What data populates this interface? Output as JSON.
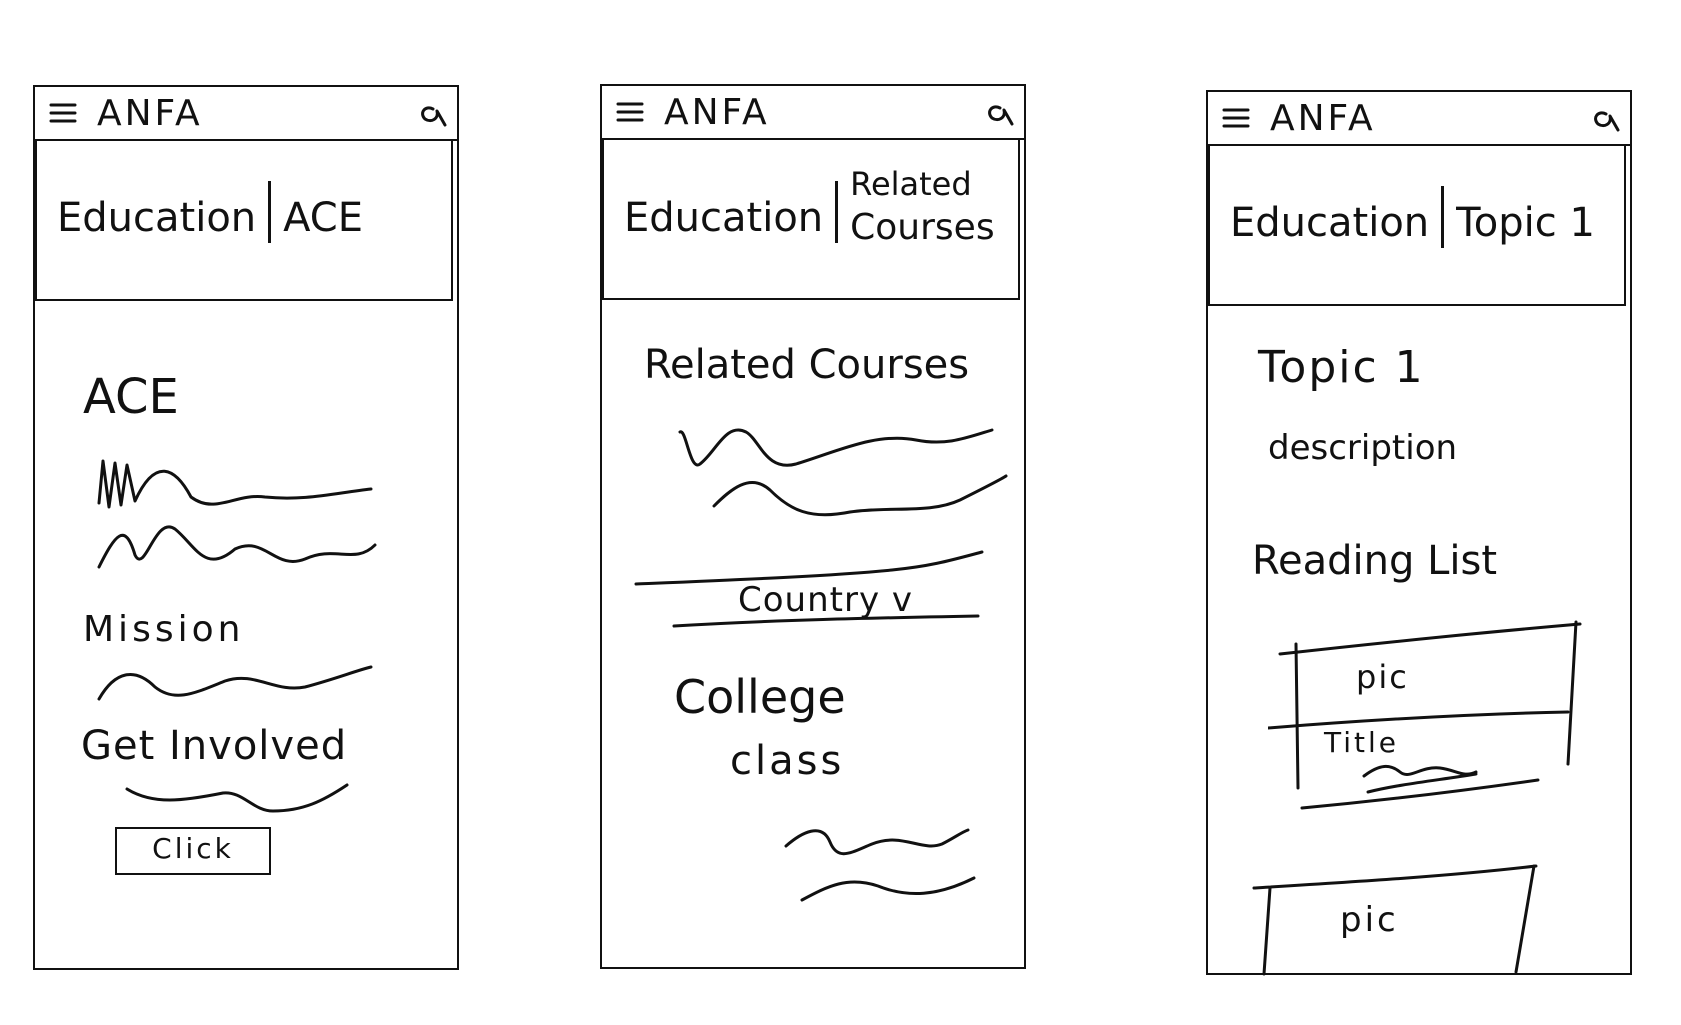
{
  "screens": [
    {
      "brand": "ANFA",
      "breadcrumb": {
        "section": "Education",
        "page": "ACE"
      },
      "content": {
        "heading": "ACE",
        "mission_label": "Mission",
        "get_involved_label": "Get Involved",
        "button_label": "Click"
      }
    },
    {
      "brand": "ANFA",
      "breadcrumb": {
        "section": "Education",
        "page_line1": "Related",
        "page_line2": "Courses"
      },
      "content": {
        "heading": "Related Courses",
        "filter_label": "Country v",
        "college_label": "College",
        "class_label": "class"
      }
    },
    {
      "brand": "ANFA",
      "breadcrumb": {
        "section": "Education",
        "page": "Topic 1"
      },
      "content": {
        "heading": "Topic 1",
        "description": "description",
        "reading_list_label": "Reading List",
        "items": [
          {
            "pic": "pic",
            "title": "Title"
          },
          {
            "pic": "pic"
          }
        ]
      }
    }
  ]
}
